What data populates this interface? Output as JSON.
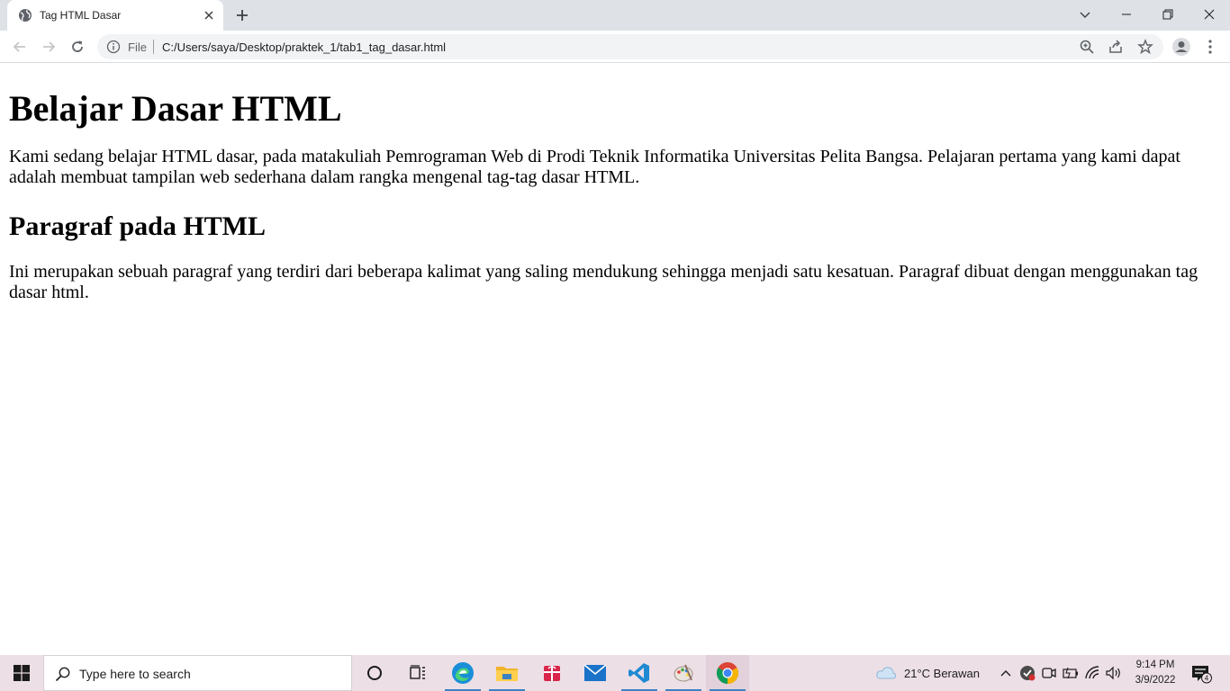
{
  "browser": {
    "tab_title": "Tag HTML Dasar",
    "omnibox_scheme": "File",
    "url": "C:/Users/saya/Desktop/praktek_1/tab1_tag_dasar.html"
  },
  "page": {
    "h1": "Belajar Dasar HTML",
    "p1": "Kami sedang belajar HTML dasar, pada matakuliah Pemrograman Web di Prodi Teknik Informatika Universitas Pelita Bangsa. Pelajaran pertama yang kami dapat adalah membuat tampilan web sederhana dalam rangka mengenal tag-tag dasar HTML.",
    "h2": "Paragraf pada HTML",
    "p2": "Ini merupakan sebuah paragraf yang terdiri dari beberapa kalimat yang saling mendukung sehingga menjadi satu kesatuan. Paragraf dibuat dengan menggunakan tag dasar html."
  },
  "taskbar": {
    "search_placeholder": "Type here to search",
    "weather": "21°C  Berawan",
    "time": "9:14 PM",
    "date": "3/9/2022",
    "notification_count": "4"
  },
  "colors": {
    "tabstrip": "#dee1e6",
    "taskbar": "#eddfe6",
    "accent": "#3b82c4"
  }
}
